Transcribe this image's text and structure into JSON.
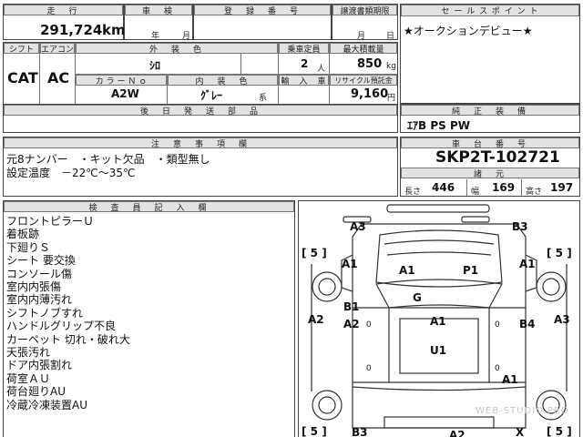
{
  "top_row": {
    "mileage_header": "走　行",
    "mileage_value": "291,724",
    "mileage_unit": "km",
    "inspection_header": "車　検",
    "inspection_year_unit": "年",
    "inspection_month_unit": "月",
    "registration_header": "登　録　番　号",
    "transfer_header": "譲渡書類期限",
    "transfer_month_unit": "月",
    "transfer_day_unit": "日"
  },
  "spec": {
    "shift_header": "シフト",
    "shift_value": "CAT",
    "ac_header": "エアコン",
    "ac_value": "AC",
    "exterior_header": "外　装　色",
    "exterior_value": "ｼﾛ",
    "capacity_header": "乗車定員",
    "capacity_value": "2",
    "capacity_unit": "人",
    "load_header": "最大積載量",
    "load_value": "850",
    "load_unit": "kg",
    "color_no_header": "カ ラ ー Ｎ ｏ",
    "color_no_value": "A2W",
    "interior_header": "内　装　色",
    "interior_value": "ｸﾞﾚｰ",
    "interior_suffix": "系",
    "import_header": "輸　入　車",
    "recycle_header": "リサイクル預託金",
    "recycle_value": "9,160",
    "recycle_unit": "円",
    "later_docs_header": "後　日　発　送　部　品"
  },
  "sales": {
    "header": "セ ー ル ス ポ イ ン ト",
    "text": "★オークションデビュー★"
  },
  "equipment": {
    "header": "純　正　装　備",
    "text": "ｴｱB PS PW"
  },
  "notes": {
    "header": "注　意　事　項　欄",
    "line1": "元8ナンバー　・キット欠品　・類型無し",
    "line2": "設定温度　－22℃～35℃"
  },
  "chassis": {
    "header": "車　台　番　号",
    "value": "SKP2T-102721",
    "dims_header": "諸　元",
    "length_label": "長さ",
    "length_value": "446",
    "width_label": "幅",
    "width_value": "169",
    "height_label": "高さ",
    "height_value": "197"
  },
  "inspector": {
    "header": "検　査　員　記　入　欄",
    "items": [
      "フロントピラーＵ",
      "着板跡",
      "下廻りＳ",
      "シート 要交換",
      "コンソール傷",
      "室内内張傷",
      "室内内薄汚れ",
      "シフトノブすれ",
      "ハンドルグリップ不良",
      "カーペット 切れ・破れ大",
      "天張汚れ",
      "ドア内張割れ",
      "荷室ＡＵ",
      "荷台廻りAU",
      "冷蔵冷凍装置AU"
    ]
  },
  "diagram": {
    "labels": {
      "a3_top_left": "A3",
      "b3_top_right": "B3",
      "a1_left_front": "A1",
      "a1_hood_left": "A1",
      "p1_hood_right": "P1",
      "a1_right_front": "A1",
      "g_windshield": "G",
      "a2_left_side": "A2",
      "b1_left_door": "B1",
      "a2_left_door": "A2",
      "a1_roof": "A1",
      "b4_right_door": "B4",
      "a3_right_side": "A3",
      "u1_center": "U1",
      "a1_rear_right": "A1",
      "b3_bottom_left": "B3",
      "a2_bottom": "A2",
      "x_bottom_right": "X"
    },
    "bracket_left_top": "[ 5 ]",
    "bracket_right_top": "[ 5 ]",
    "bracket_left_bottom": "[ 5 ]",
    "bracket_right_bottom": "[ 5 ]",
    "zero_mark": "0"
  },
  "watermark": "WEB-STUDIO.PRO"
}
